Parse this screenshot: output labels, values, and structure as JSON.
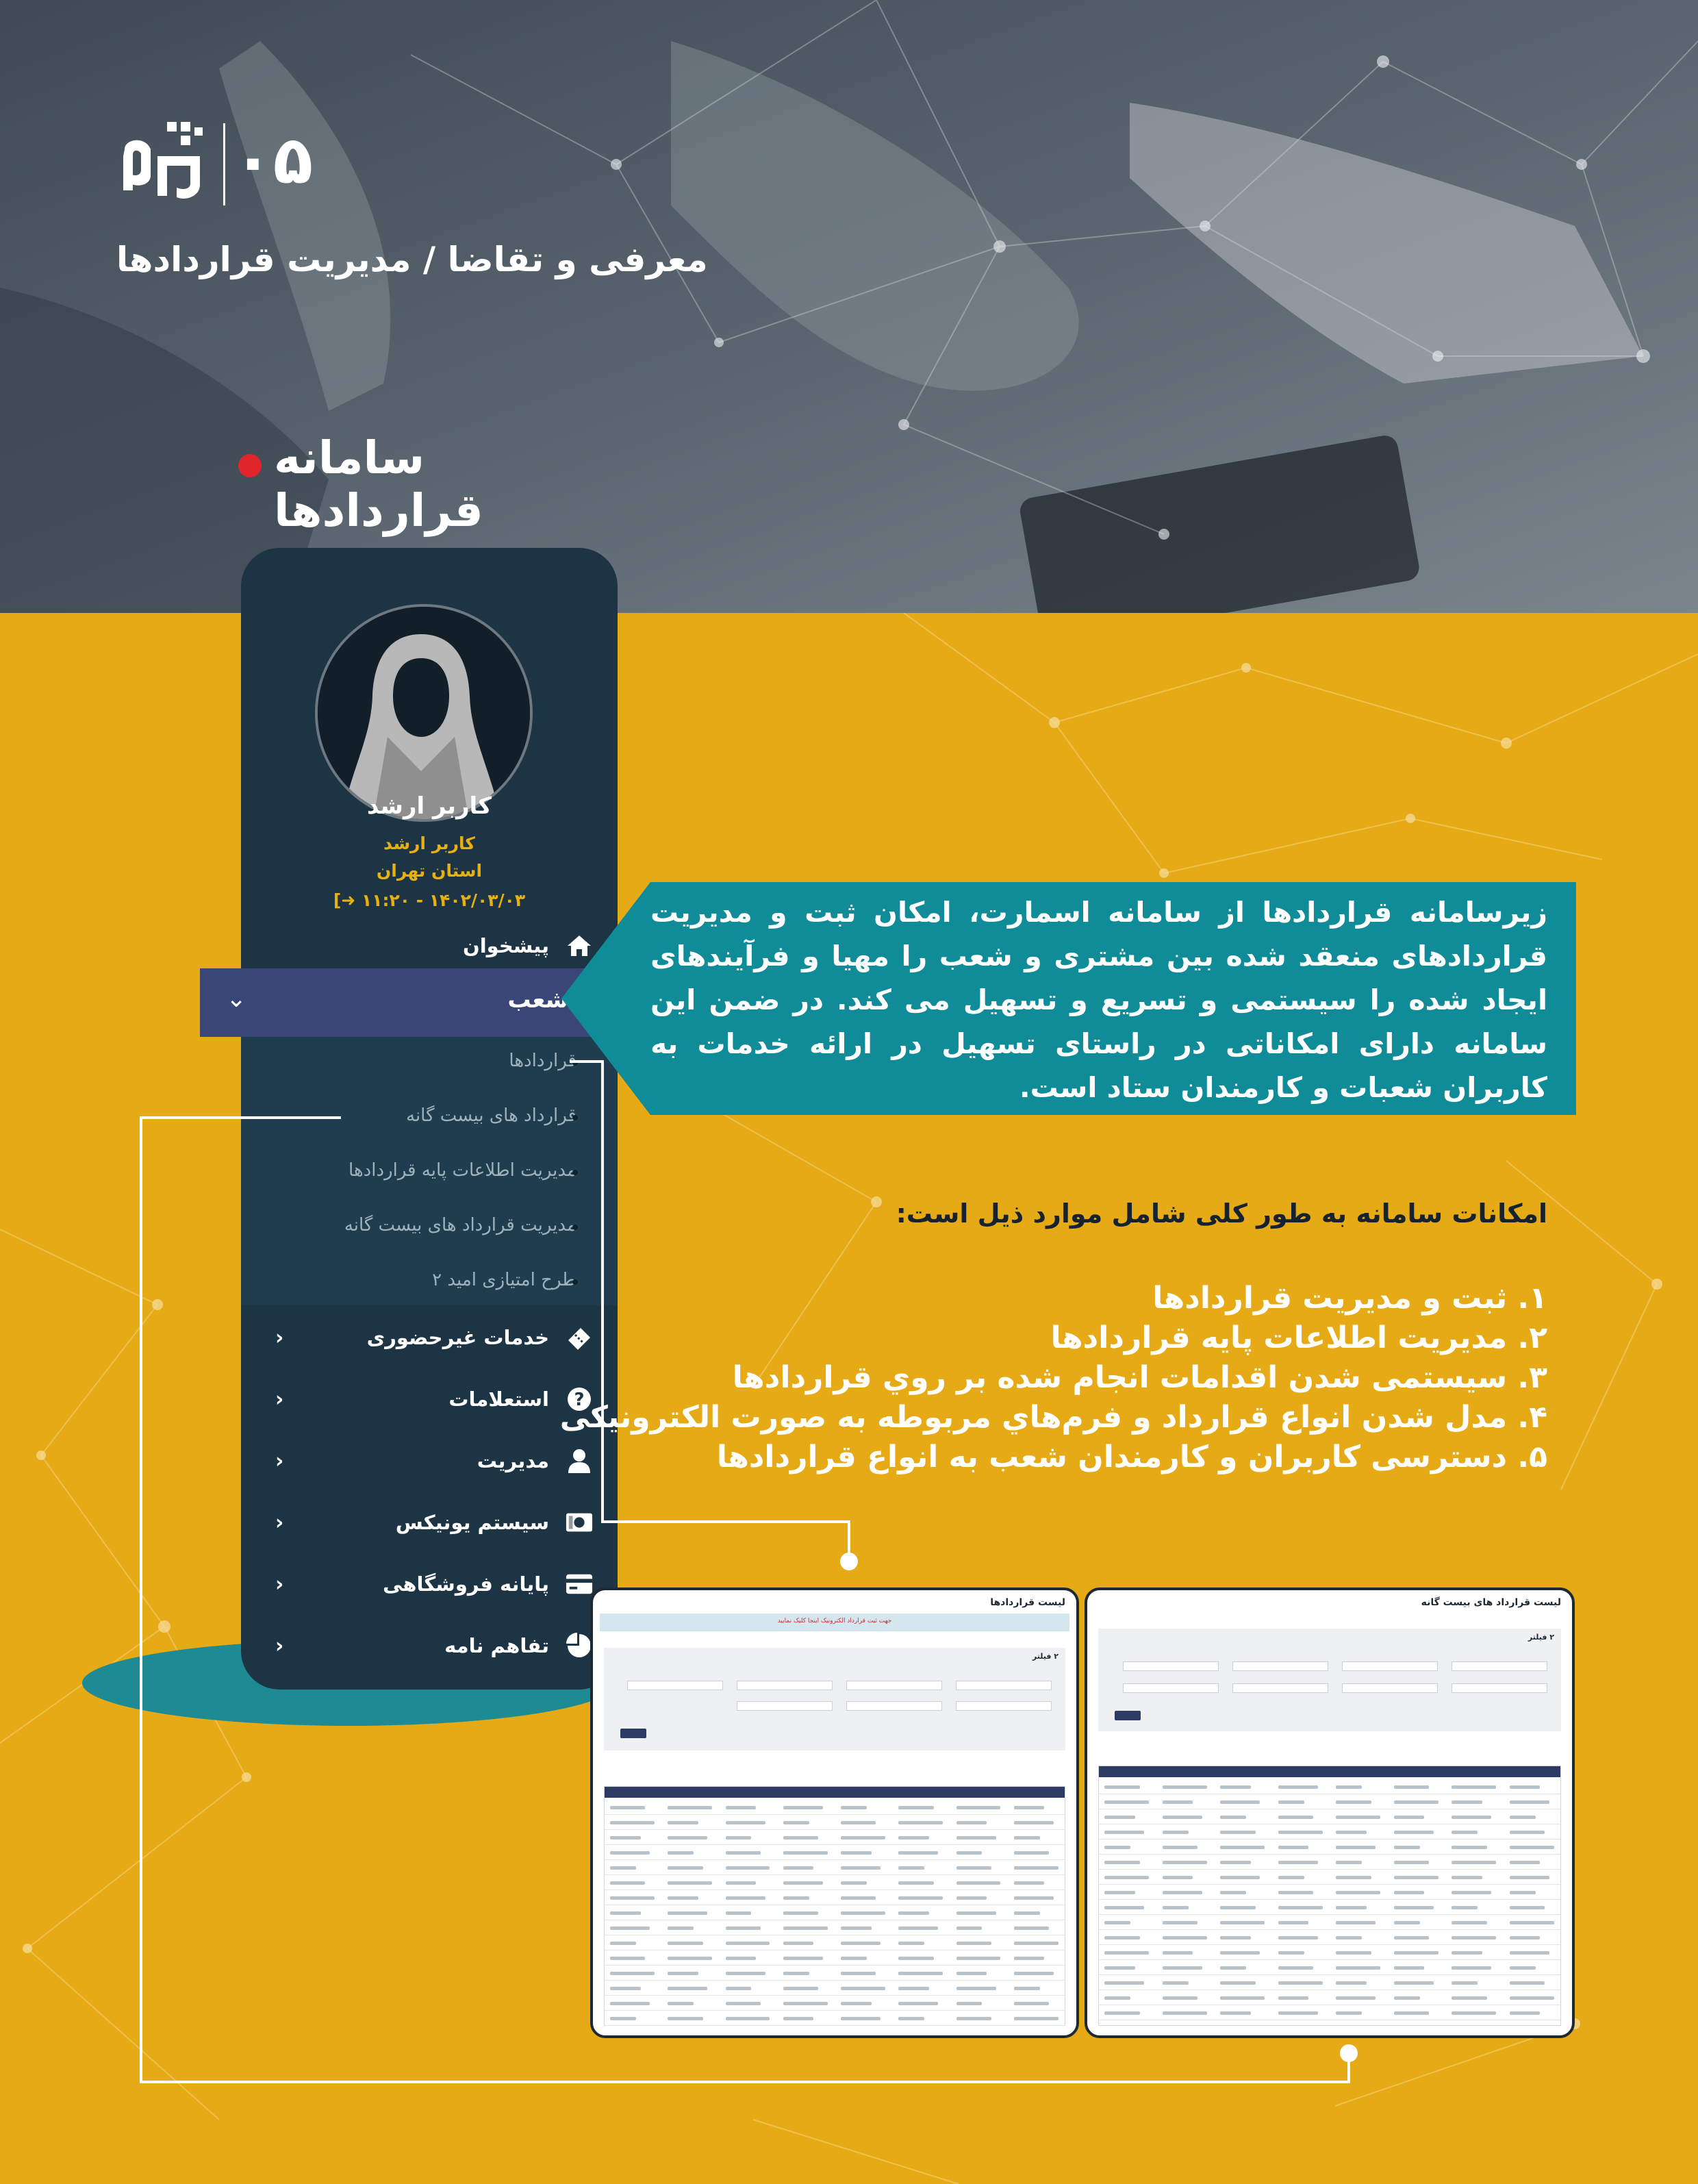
{
  "colors": {
    "background": "#e6aa16",
    "hero": "#55616b",
    "sidebar": "#1d3444",
    "sidebar_active": "#3a4677",
    "submenu": "#1f3d4f",
    "info_box": "#0f8c97",
    "title_dot": "#e0262b",
    "accent_text": "#e9b10f"
  },
  "header": {
    "page_number": "۰۵",
    "breadcrumb": "معرفی و تقاضا / مدیریت قراردادها",
    "section_title": "سامانه قراردادها"
  },
  "sidebar": {
    "user": {
      "name": "کاربر ارشد",
      "role": "کاربر ارشد",
      "province": "استان تهران",
      "login_time": "۱۴۰۲/۰۳/۰۳ - ۱۱:۲۰"
    },
    "items": [
      {
        "label": "پیشخوان",
        "icon": "home-icon",
        "chevron": ""
      },
      {
        "label": "شعب",
        "icon": "user-icon",
        "chevron": "chevron-down-icon"
      },
      {
        "label": "خدمات غیرحضوری",
        "icon": "ticket-icon",
        "chevron": "chevron-left-icon"
      },
      {
        "label": "استعلامات",
        "icon": "question-icon",
        "chevron": "chevron-left-icon"
      },
      {
        "label": "مدیریت",
        "icon": "person-icon",
        "chevron": "chevron-left-icon"
      },
      {
        "label": "سیستم یونیکس",
        "icon": "money-icon",
        "chevron": "chevron-left-icon"
      },
      {
        "label": "پایانه فروشگاهی",
        "icon": "card-icon",
        "chevron": "chevron-left-icon"
      },
      {
        "label": "تفاهم نامه",
        "icon": "pie-chart-icon",
        "chevron": "chevron-left-icon"
      }
    ],
    "submenu": [
      "قراردادها",
      "قرارداد های بیست گانه",
      "مدیریت اطلاعات پایه قراردادها",
      "مدیریت قرارداد های بیست گانه",
      "طرح امتیازی امید ۲"
    ]
  },
  "description": "زیرسامانه قراردادها از سامانه اسمارت، امکان ثبت و مدیریت قراردادهای منعقد شده بین مشتری و شعب را مهیا و فرآیندهای ایجاد شده را سیستمی و تسریع و تسهیل می کند. در ضمن این سامانه دارای امکاناتی در راستای تسهیل در ارائه خدمات به کاربران شعبات و کارمندان ستاد است.",
  "features": {
    "heading": "امکانات سامانه به طور کلی شامل موارد ذیل است:",
    "items": [
      "۱. ثبت و مدیریت قراردادها",
      "۲. مدیریت اطلاعات پایه قراردادها",
      "۳. سیستمی شدن اقدامات انجام شده بر روي قراردادها",
      "۴. مدل شدن انواع قرارداد و فرم‌هاي مربوطه به صورت الکترونیکی",
      "۵. دسترسی کاربران و کارمندان شعب به انواع قراردادها"
    ]
  },
  "screenshots": {
    "right": {
      "title": "لیست قرارداد های بیست گانه",
      "filter_label": "۲ فیلتر"
    },
    "left": {
      "title": "لیست قراردادها",
      "bar_text": "جهت ثبت قرارداد الکترونیک اینجا کلیک نمایید",
      "filter_label": "۲ فیلتر"
    }
  }
}
